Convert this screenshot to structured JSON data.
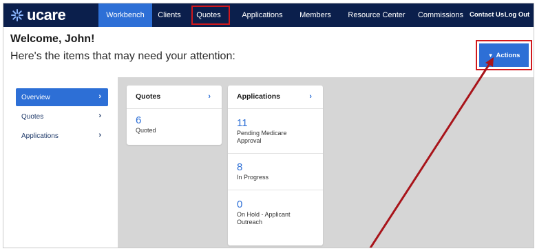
{
  "brand": {
    "logo_text": "ucare",
    "nav_bg": "#0b1f4c",
    "accent": "#2d6fd6",
    "annotation": "#d1181c"
  },
  "nav": {
    "items": [
      "Workbench",
      "Clients",
      "Quotes",
      "Applications",
      "Members",
      "Resource Center",
      "Commissions"
    ],
    "contact": "Contact Us",
    "logout": "Log Out"
  },
  "header": {
    "welcome": "Welcome, John!",
    "subtitle": "Here's the items that may need your attention:",
    "actions": "Actions"
  },
  "sidebar": {
    "items": [
      "Overview",
      "Quotes",
      "Applications"
    ],
    "active": "Overview"
  },
  "cards": {
    "quotes": {
      "title": "Quotes",
      "stats": [
        {
          "value": "6",
          "label": "Quoted"
        }
      ]
    },
    "applications": {
      "title": "Applications",
      "stats": [
        {
          "value": "11",
          "label_line1": "Pending Medicare",
          "label_line2": "Approval"
        },
        {
          "value": "8",
          "label": "In Progress"
        },
        {
          "value": "0",
          "label_line1": "On Hold - Applicant",
          "label_line2": "Outreach"
        }
      ]
    }
  }
}
